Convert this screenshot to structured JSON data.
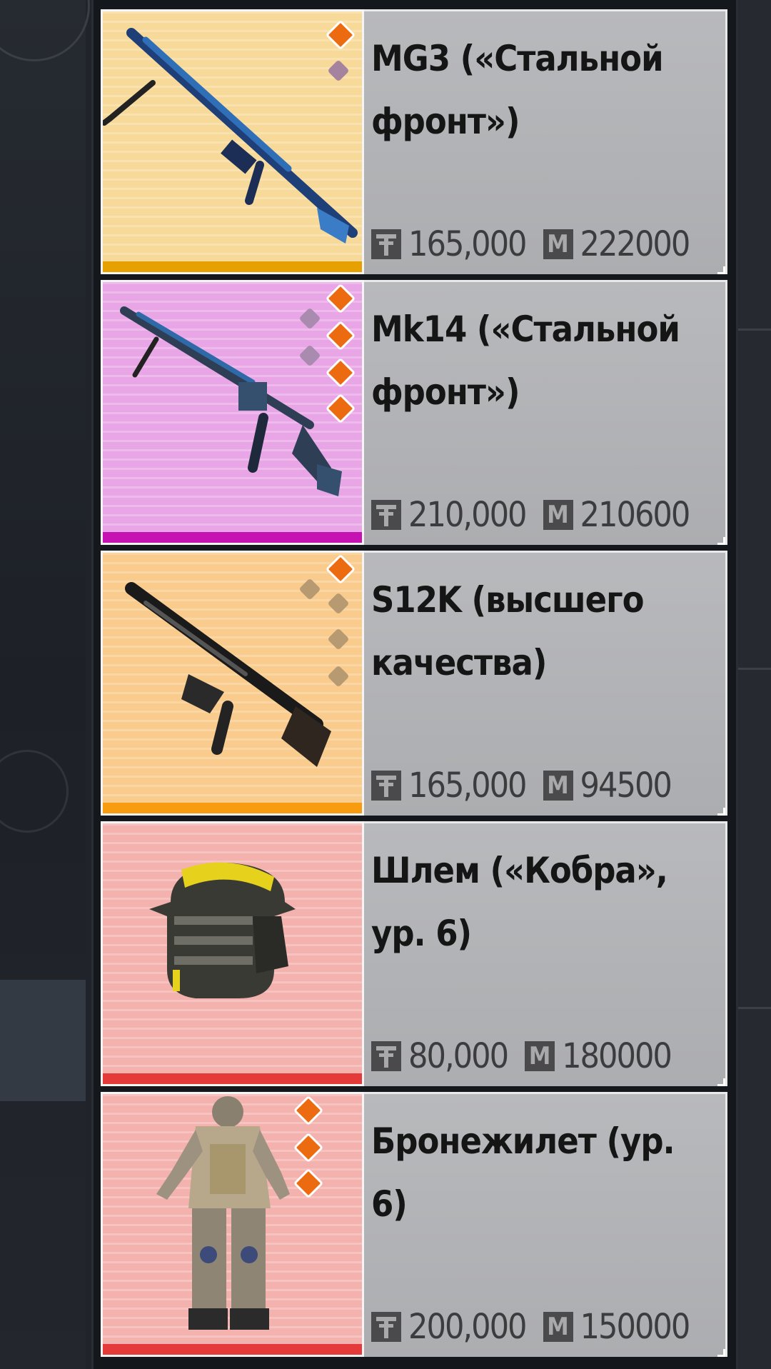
{
  "items": [
    {
      "name": "MG3 («Стальной фронт»)",
      "price_bp": "165,000",
      "price_m": "222000",
      "bg_color": "#f7d99a",
      "bar_color": "#e6a100",
      "dots_on": 1,
      "dots_off": 1,
      "dot_off_color": "#a5829e",
      "icon": "mg3-machine-gun-icon"
    },
    {
      "name": "Mk14 («Стальной фронт»)",
      "price_bp": "210,000",
      "price_m": "210600",
      "bg_color": "#e9a6e6",
      "bar_color": "#c712b3",
      "dots_on": 4,
      "dots_off": 2,
      "dot_off_color": "#a98bb0",
      "icon": "mk14-rifle-icon"
    },
    {
      "name": "S12K (высшего качества)",
      "price_bp": "165,000",
      "price_m": "94500",
      "bg_color": "#f9cb8c",
      "bar_color": "#f79b0f",
      "dots_on": 1,
      "dots_off": 4,
      "dot_off_color": "#b79a72",
      "icon": "s12k-shotgun-icon"
    },
    {
      "name": "Шлем («Кобра», ур. 6)",
      "price_bp": "80,000",
      "price_m": "180000",
      "bg_color": "#f3b2ae",
      "bar_color": "#e53a3a",
      "dots_on": 0,
      "dots_off": 0,
      "dot_off_color": "#000000",
      "icon": "helmet-icon"
    },
    {
      "name": "Бронежилет (ур. 6)",
      "price_bp": "200,000",
      "price_m": "150000",
      "bg_color": "#f3b2ae",
      "bar_color": "#e53a3a",
      "dots_on": 3,
      "dots_off": 0,
      "dot_off_color": "#000000",
      "icon": "armor-suit-icon"
    }
  ],
  "currency_bp_icon": "battle-points-icon",
  "currency_m_icon": "m-coin-icon",
  "currency_m_glyph": "M"
}
